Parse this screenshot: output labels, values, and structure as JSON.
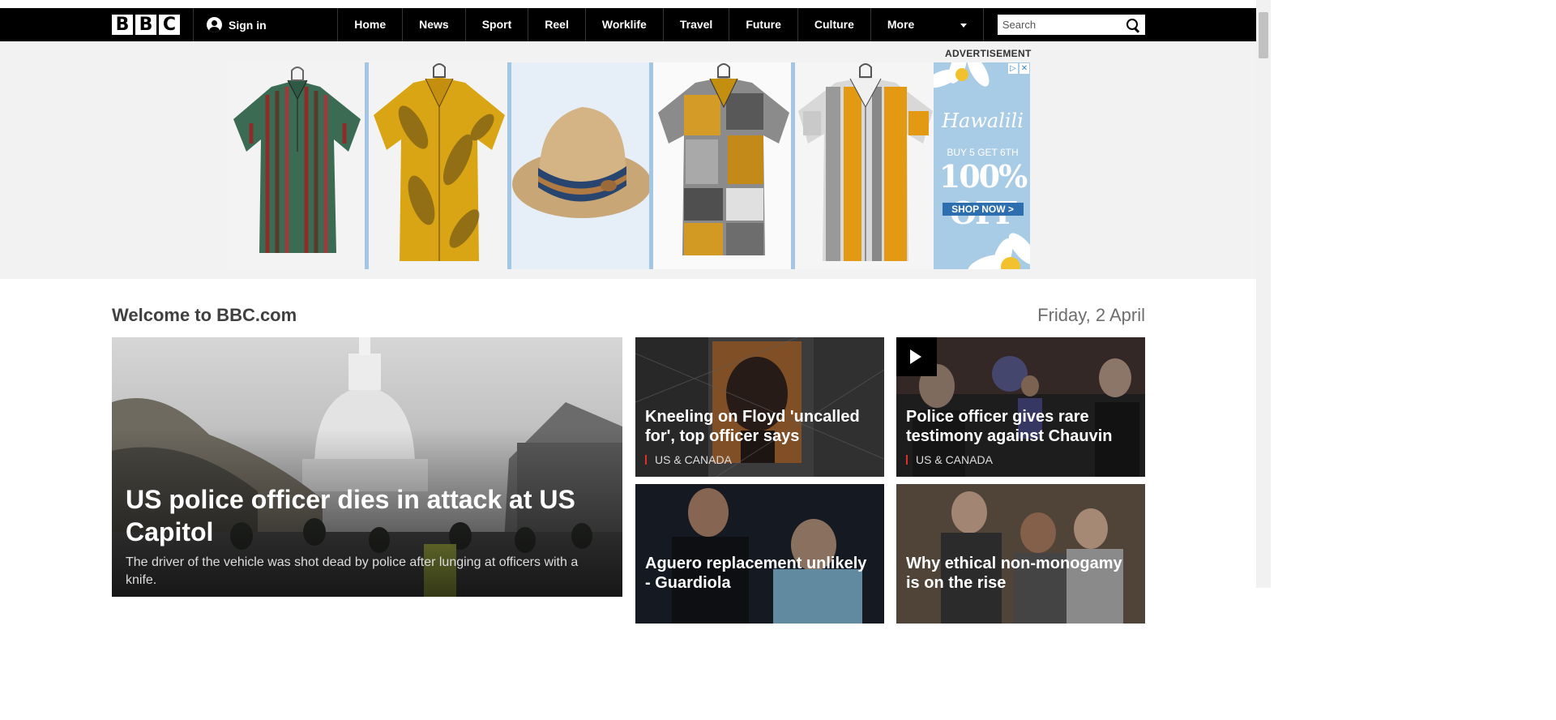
{
  "header": {
    "logo_letters": [
      "B",
      "B",
      "C"
    ],
    "sign_in": "Sign in",
    "nav": [
      "Home",
      "News",
      "Sport",
      "Reel",
      "Worklife",
      "Travel",
      "Future",
      "Culture"
    ],
    "more": "More",
    "search_placeholder": "Search"
  },
  "ad": {
    "label": "ADVERTISEMENT",
    "brand": "Hawalili",
    "offer_line1": "BUY 5 GET 6TH",
    "offer_line2": "100% OFF",
    "cta": "SHOP NOW >",
    "products": [
      "striped-shirt",
      "yellow-leaf-shirt",
      "straw-hat",
      "patchwork-shirt",
      "orange-stripe-shirt"
    ]
  },
  "main": {
    "welcome": "Welcome to BBC.com",
    "date": "Friday, 2 April",
    "lead": {
      "title": "US police officer dies in attack at US Capitol",
      "summary": "The driver of the vehicle was shot dead by police after lunging at officers with a knife."
    },
    "cards": [
      {
        "title": "Kneeling on Floyd 'uncalled for', top officer says",
        "tag": "US & CANADA",
        "video": false
      },
      {
        "title": "Police officer gives rare testimony against Chauvin",
        "tag": "US & CANADA",
        "video": true
      },
      {
        "title": "Aguero replacement unlikely - Guardiola",
        "tag": "",
        "video": false
      },
      {
        "title": "Why ethical non-monogamy is on the rise",
        "tag": "",
        "video": false
      }
    ]
  }
}
